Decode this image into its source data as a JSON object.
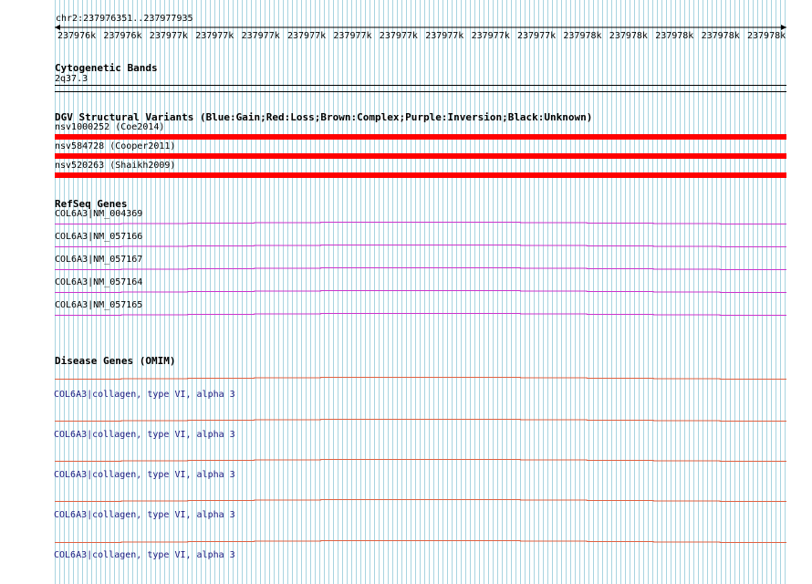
{
  "position": {
    "label": "chr2:237976351..237977935",
    "ticks": [
      "237976k",
      "237976k",
      "237977k",
      "237977k",
      "237977k",
      "237977k",
      "237977k",
      "237977k",
      "237977k",
      "237977k",
      "237977k",
      "237978k",
      "237978k",
      "237978k",
      "237978k",
      "237978k"
    ]
  },
  "cytobands": {
    "title": "Cytogenetic Bands",
    "band": "2q37.3"
  },
  "dgv": {
    "title": "DGV Structural Variants (Blue:Gain;Red:Loss;Brown:Complex;Purple:Inversion;Black:Unknown)",
    "loss_color": "#ff0000",
    "items": [
      {
        "label": "nsv1000252 (Coe2014)"
      },
      {
        "label": "nsv584728 (Cooper2011)"
      },
      {
        "label": "nsv520263 (Shaikh2009)"
      }
    ]
  },
  "refseq": {
    "title": "RefSeq Genes",
    "color": "#cc33cc",
    "items": [
      {
        "label": "COL6A3|NM_004369"
      },
      {
        "label": "COL6A3|NM_057166"
      },
      {
        "label": "COL6A3|NM_057167"
      },
      {
        "label": "COL6A3|NM_057164"
      },
      {
        "label": "COL6A3|NM_057165"
      }
    ]
  },
  "omim": {
    "title": "Disease Genes (OMIM)",
    "color": "#e06040",
    "items": [
      {
        "label": "COL6A3|collagen, type VI, alpha 3"
      },
      {
        "label": "COL6A3|collagen, type VI, alpha 3"
      },
      {
        "label": "COL6A3|collagen, type VI, alpha 3"
      },
      {
        "label": "COL6A3|collagen, type VI, alpha 3"
      },
      {
        "label": "COL6A3|collagen, type VI, alpha 3"
      }
    ]
  },
  "colors": {
    "grid": "#a8d4e0"
  }
}
